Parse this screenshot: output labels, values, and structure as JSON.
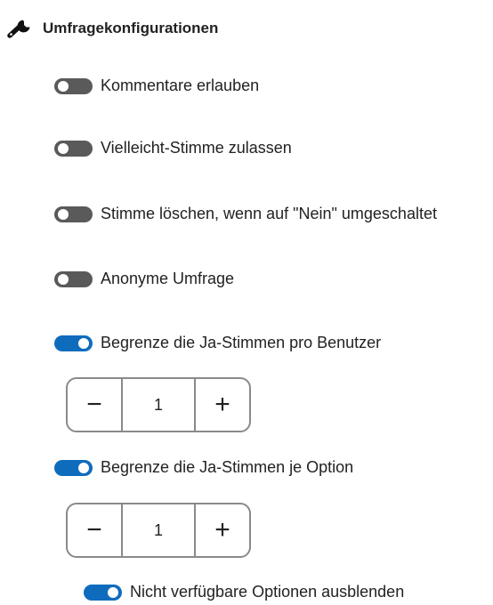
{
  "section": {
    "title": "Umfragekonfigurationen",
    "icon": "wrench-icon"
  },
  "options": [
    {
      "label": "Kommentare erlauben",
      "on": false
    },
    {
      "label": "Vielleicht-Stimme zulassen",
      "on": false
    },
    {
      "label": "Stimme löschen, wenn auf \"Nein\" umgeschaltet",
      "on": false
    },
    {
      "label": "Anonyme Umfrage",
      "on": false
    },
    {
      "label": "Begrenze die Ja-Stimmen pro Benutzer",
      "on": true
    },
    {
      "label": "Begrenze die Ja-Stimmen je Option",
      "on": true
    },
    {
      "label": "Nicht verfügbare Optionen ausblenden",
      "on": true
    }
  ],
  "steppers": {
    "per_user": {
      "value": "1",
      "minus": "−",
      "plus": "+"
    },
    "per_option": {
      "value": "1",
      "minus": "−",
      "plus": "+"
    }
  },
  "colors": {
    "toggle_on": "#0f6cbd",
    "toggle_off": "#5a5a5a",
    "stepper_border": "#8a8a8a"
  }
}
